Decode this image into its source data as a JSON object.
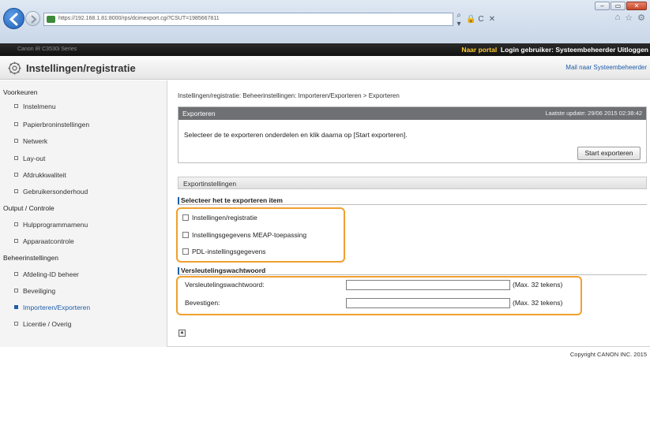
{
  "browser": {
    "url": "https://192.168.1.81:8000/rps/dcimexport.cgi?CSUT=1985667811",
    "tools": [
      "⌕ ▾",
      "🔒",
      "C",
      "✕"
    ],
    "window_controls": [
      "–",
      "▭",
      "✕"
    ],
    "right_icons": [
      "⌂",
      "☆",
      "⚙"
    ]
  },
  "appbar": {
    "left": "Canon iR  C3530i  Series",
    "portal_link": "Naar portal",
    "login_user": "Login gebruiker: Systeembeheerder",
    "logout": "Uitloggen"
  },
  "page": {
    "title": "Instellingen/registratie",
    "mail_link": "Mail naar Systeembeheerder"
  },
  "sidebar": {
    "groups": [
      {
        "heading": "Voorkeuren",
        "items": [
          {
            "label": "Instelmenu",
            "active": false
          },
          {
            "label": "Papierbroninstellingen",
            "active": false
          },
          {
            "label": "Netwerk",
            "active": false
          },
          {
            "label": "Lay-out",
            "active": false
          },
          {
            "label": "Afdrukkwaliteit",
            "active": false
          },
          {
            "label": "Gebruikersonderhoud",
            "active": false
          }
        ]
      },
      {
        "heading": "Output / Controle",
        "items": [
          {
            "label": "Hulpprogrammamenu",
            "active": false
          },
          {
            "label": "Apparaatcontrole",
            "active": false
          }
        ]
      },
      {
        "heading": "Beheerinstellingen",
        "items": [
          {
            "label": "Afdeling-ID beheer",
            "active": false
          },
          {
            "label": "Beveiliging",
            "active": false
          },
          {
            "label": "Importeren/Exporteren",
            "active": true
          },
          {
            "label": "Licentie / Overig",
            "active": false
          }
        ]
      }
    ]
  },
  "main": {
    "breadcrumb": "Instellingen/registratie: Beheerinstellingen: Importeren/Exporteren > Exporteren",
    "panel_title": "Exporteren",
    "last_update": "Laatste update: 29/06 2015 02:38:42",
    "description": "Selecteer de te exporteren onderdelen en klik daarna op [Start exporteren].",
    "start_button": "Start exporteren",
    "section_title": "Exportinstellingen",
    "items_heading": "Selecteer het te exporteren item",
    "items": [
      {
        "label": "Instellingen/registratie",
        "checked": false
      },
      {
        "label": "Instellingsgegevens MEAP-toepassing",
        "checked": false
      },
      {
        "label": "PDL-instellingsgegevens",
        "checked": false
      }
    ],
    "password_heading": "Versleutelingswachtwoord",
    "password_fields": [
      {
        "label": "Versleutelingswachtwoord:",
        "value": "",
        "hint": "(Max. 32 tekens)"
      },
      {
        "label": "Bevestigen:",
        "value": "",
        "hint": "(Max. 32 tekens)"
      }
    ],
    "top_icon": "▲"
  },
  "footer": {
    "copyright": "Copyright CANON INC. 2015"
  },
  "colors": {
    "highlight": "#f0a030",
    "link": "#1f5ea8",
    "panel_header": "#6f7074",
    "appbar_link": "#ffcc33"
  }
}
